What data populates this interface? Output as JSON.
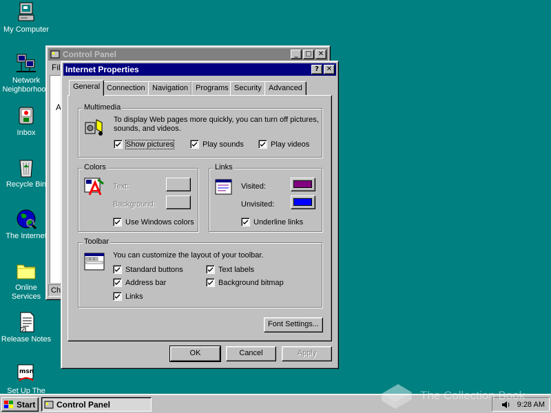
{
  "desktop": {
    "icons": [
      {
        "label": "My Computer"
      },
      {
        "label": "Network Neighborhood"
      },
      {
        "label": "Inbox"
      },
      {
        "label": "Recycle Bin"
      },
      {
        "label": "The Internet"
      },
      {
        "label": "Online Services"
      },
      {
        "label": "Release Notes"
      },
      {
        "label": "Set Up The"
      }
    ]
  },
  "control_panel": {
    "title": "Control Panel",
    "menu_first": "Fil",
    "content_letter": "A",
    "status_fragment": "Ch"
  },
  "dialog": {
    "title": "Internet Properties",
    "help_btn": "?",
    "close_btn": "✕",
    "tabs": [
      "General",
      "Connection",
      "Navigation",
      "Programs",
      "Security",
      "Advanced"
    ],
    "multimedia": {
      "legend": "Multimedia",
      "description": "To display Web pages more quickly, you can turn off pictures, sounds, and videos.",
      "show_pictures": "Show pictures",
      "play_sounds": "Play sounds",
      "play_videos": "Play videos"
    },
    "colors": {
      "legend": "Colors",
      "text": "Text:",
      "background": "Background:",
      "use_windows_colors": "Use Windows colors"
    },
    "links": {
      "legend": "Links",
      "visited": "Visited:",
      "unvisited": "Unvisited:",
      "underline_links": "Underline links",
      "visited_color": "#800080",
      "unvisited_color": "#0000ff"
    },
    "toolbar": {
      "legend": "Toolbar",
      "description": "You can customize the layout of your toolbar.",
      "standard_buttons": "Standard buttons",
      "address_bar": "Address bar",
      "links": "Links",
      "text_labels": "Text labels",
      "background_bitmap": "Background bitmap"
    },
    "font_settings": "Font Settings...",
    "ok": "OK",
    "cancel": "Cancel",
    "apply": "Apply"
  },
  "taskbar": {
    "start": "Start",
    "task": "Control Panel",
    "clock": "9:28 AM"
  },
  "watermark": "The Collection Book"
}
